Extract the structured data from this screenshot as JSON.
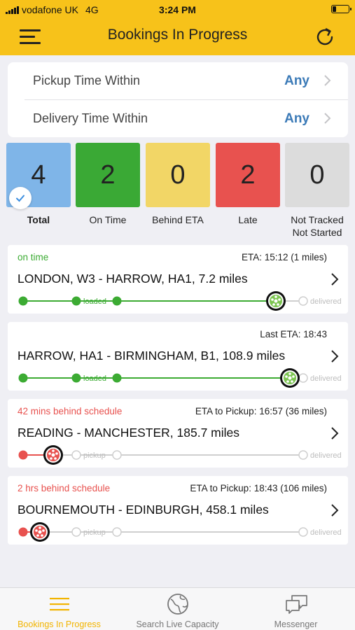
{
  "status_bar": {
    "carrier": "vodafone UK",
    "network": "4G",
    "time": "3:24 PM"
  },
  "header": {
    "title": "Bookings In Progress",
    "menu_icon": "hamburger-icon",
    "refresh_icon": "refresh-icon"
  },
  "filters": [
    {
      "label": "Pickup Time Within",
      "value": "Any"
    },
    {
      "label": "Delivery Time Within",
      "value": "Any"
    }
  ],
  "summary": [
    {
      "count": "4",
      "label": "Total",
      "color": "#7fb5e8",
      "selected": true
    },
    {
      "count": "2",
      "label": "On Time",
      "color": "#3aa935"
    },
    {
      "count": "0",
      "label": "Behind ETA",
      "color": "#f2d666"
    },
    {
      "count": "2",
      "label": "Late",
      "color": "#e8524f"
    },
    {
      "count": "0",
      "label": "Not Tracked\nNot Started",
      "color": "#dcdcdc"
    }
  ],
  "bookings": [
    {
      "status": "on time",
      "status_type": "green",
      "eta": "ETA: 15:12 (1 miles)",
      "route": "LONDON, W3 - HARROW, HA1, 7.2 miles",
      "stage": "near-delivery",
      "mid_label": "loaded",
      "end_label": "delivered"
    },
    {
      "status": "",
      "status_type": "green",
      "eta": "Last ETA: 18:43",
      "route": "HARROW, HA1 - BIRMINGHAM, B1, 108.9 miles",
      "stage": "near-delivery-2",
      "mid_label": "loaded",
      "end_label": "delivered"
    },
    {
      "status": "42 mins behind schedule",
      "status_type": "red",
      "eta": "ETA to Pickup: 16:57 (36 miles)",
      "route": "READING - MANCHESTER, 185.7 miles",
      "stage": "to-pickup",
      "mid_label": "pickup",
      "end_label": "delivered"
    },
    {
      "status": "2 hrs behind schedule",
      "status_type": "red",
      "eta": "ETA to Pickup: 18:43 (106 miles)",
      "route": "BOURNEMOUTH - EDINBURGH, 458.1 miles",
      "stage": "start",
      "mid_label": "pickup",
      "end_label": "delivered"
    }
  ],
  "tabs": [
    {
      "label": "Bookings In Progress",
      "icon": "list-icon",
      "active": true
    },
    {
      "label": "Search Live Capacity",
      "icon": "globe-icon",
      "active": false
    },
    {
      "label": "Messenger",
      "icon": "chat-bubbles-icon",
      "active": false
    }
  ]
}
